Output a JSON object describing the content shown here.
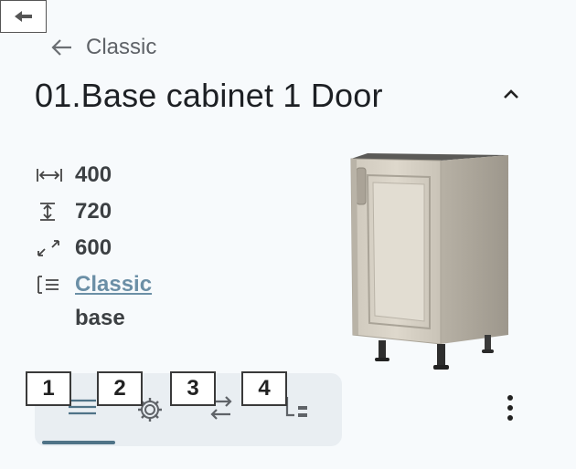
{
  "header": {
    "back_icon": "arrow-left-icon",
    "breadcrumb": {
      "icon": "arrow-left-icon",
      "label": "Classic"
    },
    "title": "01.Base cabinet 1 Door",
    "collapse_icon": "chevron-up-icon"
  },
  "specs": {
    "width": {
      "icon": "width-icon",
      "value": "400"
    },
    "height": {
      "icon": "height-icon",
      "value": "720"
    },
    "depth": {
      "icon": "depth-icon",
      "value": "600"
    },
    "style": {
      "icon": "list-icon",
      "value": "Classic"
    },
    "type": {
      "value": "base"
    }
  },
  "tabs": [
    {
      "number": "1",
      "icon": "menu-lines-icon",
      "active": true
    },
    {
      "number": "2",
      "icon": "gear-icon",
      "active": false
    },
    {
      "number": "3",
      "icon": "swap-icon",
      "active": false
    },
    {
      "number": "4",
      "icon": "tree-list-icon",
      "active": false
    }
  ],
  "more_icon": "kebab-menu-icon",
  "colors": {
    "accent": "#4f7387",
    "link": "#6b8fa6",
    "tabs_bg": "#e9eef2"
  }
}
